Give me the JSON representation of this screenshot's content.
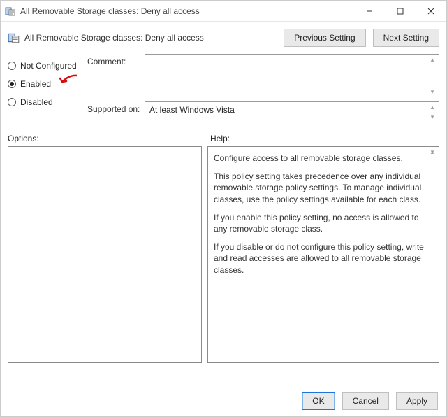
{
  "titlebar": {
    "title": "All Removable Storage classes: Deny all access"
  },
  "header": {
    "title": "All Removable Storage classes: Deny all access",
    "prev": "Previous Setting",
    "next": "Next Setting"
  },
  "radios": {
    "not_configured": "Not Configured",
    "enabled": "Enabled",
    "disabled": "Disabled",
    "selected": "enabled"
  },
  "fields": {
    "comment_label": "Comment:",
    "comment_value": "",
    "supported_label": "Supported on:",
    "supported_value": "At least Windows Vista"
  },
  "labels": {
    "options": "Options:",
    "help": "Help:"
  },
  "help": {
    "p1": "Configure access to all removable storage classes.",
    "p2": "This policy setting takes precedence over any individual removable storage policy settings. To manage individual classes, use the policy settings available for each class.",
    "p3": "If you enable this policy setting, no access is allowed to any removable storage class.",
    "p4": "If you disable or do not configure this policy setting, write and read accesses are allowed to all removable storage classes."
  },
  "footer": {
    "ok": "OK",
    "cancel": "Cancel",
    "apply": "Apply"
  }
}
